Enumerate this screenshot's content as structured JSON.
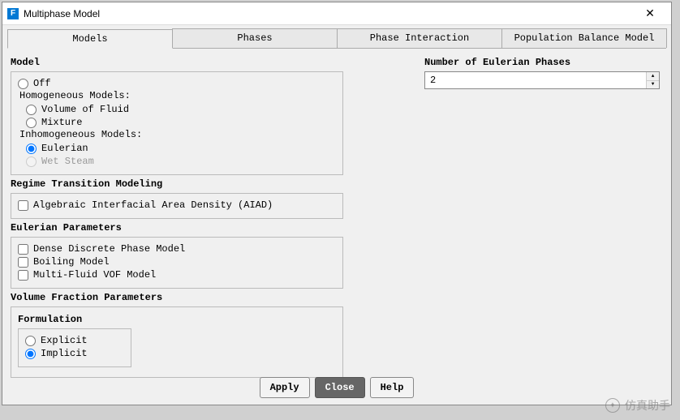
{
  "window": {
    "title": "Multiphase Model"
  },
  "tabs": {
    "models": "Models",
    "phases": "Phases",
    "phase_interaction": "Phase Interaction",
    "pbm": "Population Balance Model"
  },
  "model": {
    "legend": "Model",
    "off": "Off",
    "homogeneous": "Homogeneous Models:",
    "vof": "Volume of Fluid",
    "mixture": "Mixture",
    "inhomogeneous": "Inhomogeneous Models:",
    "eulerian": "Eulerian",
    "wetsteam": "Wet Steam"
  },
  "regime": {
    "legend": "Regime Transition Modeling",
    "aiad": "Algebraic Interfacial Area Density (AIAD)"
  },
  "euler_params": {
    "legend": "Eulerian Parameters",
    "ddpm": "Dense Discrete Phase Model",
    "boiling": "Boiling Model",
    "mfvof": "Multi-Fluid VOF Model"
  },
  "vfp": {
    "legend": "Volume Fraction Parameters",
    "formulation": "Formulation",
    "explicit": "Explicit",
    "implicit": "Implicit"
  },
  "num_phases": {
    "label": "Number of Eulerian Phases",
    "value": "2"
  },
  "buttons": {
    "apply": "Apply",
    "close": "Close",
    "help": "Help"
  },
  "watermark": "仿真助手"
}
